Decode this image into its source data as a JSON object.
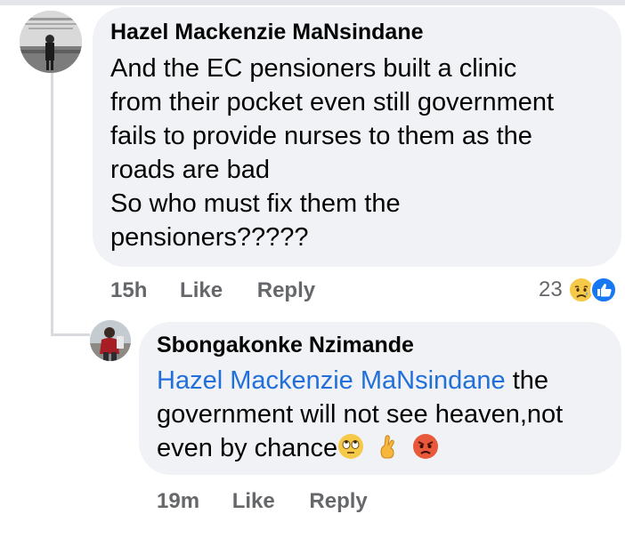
{
  "comment": {
    "author": "Hazel Mackenzie MaNsindane",
    "text_lines": [
      "And the EC pensioners built a clinic",
      "from their pocket even still government",
      "fails to provide nurses to them as the",
      "roads are bad",
      "So who must fix them the",
      "pensioners?????"
    ],
    "time": "15h",
    "like_label": "Like",
    "reply_label": "Reply",
    "reaction_count": "23",
    "reaction_icons": [
      "sad-reaction-icon",
      "like-reaction-icon"
    ]
  },
  "reply": {
    "author": "Sbongakonke Nzimande",
    "mention": "Hazel Mackenzie MaNsindane",
    "text_after_mention": " the",
    "text_line_2": "government will not see heaven,not",
    "text_line_3": "even by chance",
    "emojis": [
      "eye-roll-emoji-icon",
      "crossed-fingers-emoji-icon",
      "angry-emoji-icon"
    ],
    "time": "19m",
    "like_label": "Like",
    "reply_label": "Reply"
  },
  "colors": {
    "bubble": "#f0f2f5",
    "meta_text": "#65676b",
    "mention": "#216fdb",
    "like_blue": "#1877f2"
  }
}
